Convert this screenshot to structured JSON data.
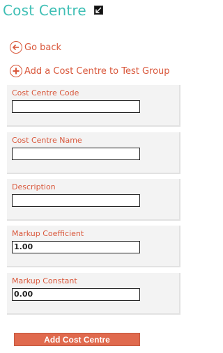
{
  "header": {
    "title": "Cost Centre",
    "popout_icon": "popout-arrow-icon"
  },
  "links": {
    "go_back": "Go back",
    "add_to_group": "Add a Cost Centre to Test Group"
  },
  "form": {
    "fields": [
      {
        "label": "Cost Centre Code",
        "value": ""
      },
      {
        "label": "Cost Centre Name",
        "value": ""
      },
      {
        "label": "Description",
        "value": ""
      },
      {
        "label": "Markup Coefficient",
        "value": "1.00"
      },
      {
        "label": "Markup Constant",
        "value": "0.00"
      }
    ],
    "submit_label": "Add Cost Centre"
  },
  "colors": {
    "title": "#3fbfb5",
    "accent": "#d9573b",
    "button": "#e06a4e"
  }
}
